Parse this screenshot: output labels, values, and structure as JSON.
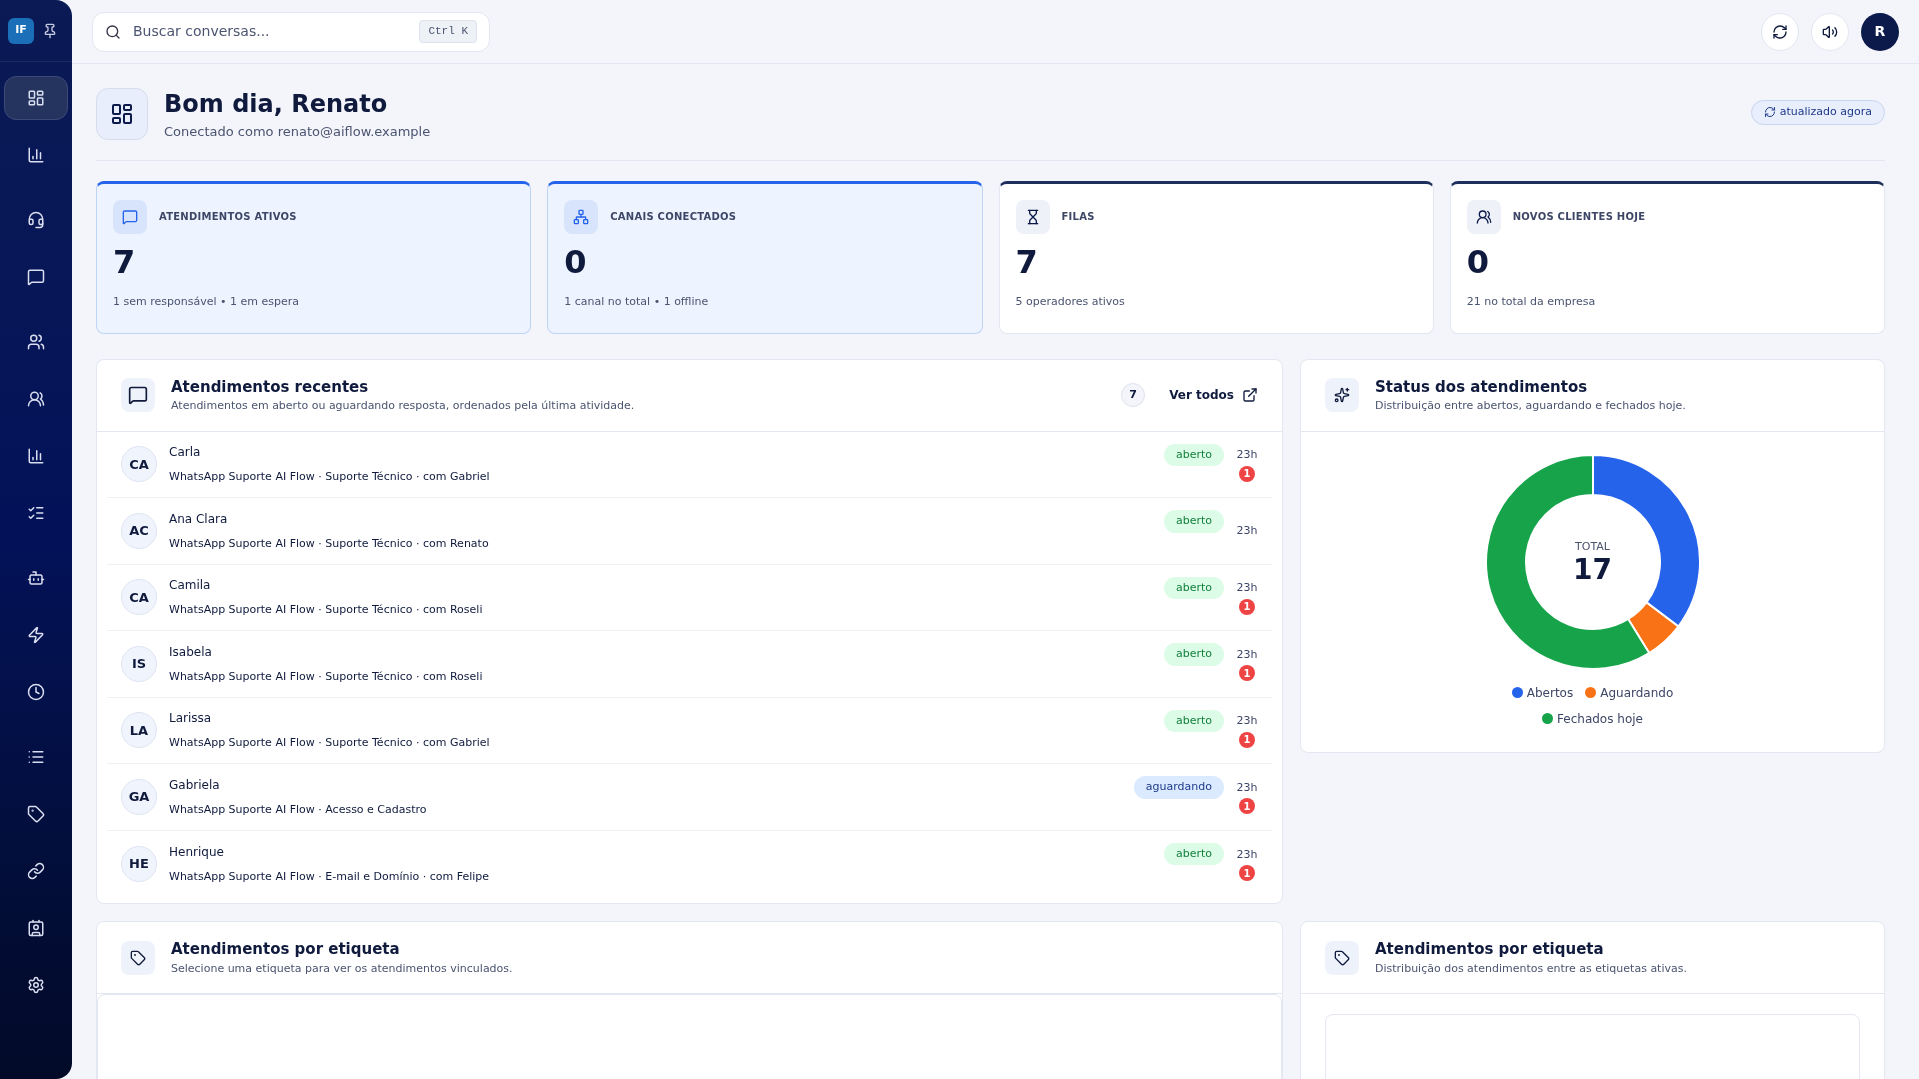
{
  "sidebar": {
    "logo": "IF",
    "items": [
      {
        "selected": true
      },
      {
        "selected": false
      },
      {
        "selected": false
      },
      {
        "selected": false
      },
      {
        "selected": false
      },
      {
        "selected": false
      },
      {
        "selected": false
      },
      {
        "selected": false
      },
      {
        "selected": false
      },
      {
        "selected": false
      },
      {
        "selected": false
      },
      {
        "selected": false
      },
      {
        "selected": false
      },
      {
        "selected": false
      },
      {
        "selected": false
      },
      {
        "selected": false
      }
    ]
  },
  "topbar": {
    "search": {
      "placeholder": "Buscar conversas...",
      "shortcut": "Ctrl K"
    },
    "avatar": "R"
  },
  "header": {
    "title": "Bom dia, Renato",
    "subtitle": "Conectado como renato@aiflow.example",
    "status": "atualizado agora"
  },
  "kpis": [
    {
      "label": "ATENDIMENTOS ATIVOS",
      "value": "7",
      "note": "1 sem responsável • 1 em espera",
      "highlighted": true
    },
    {
      "label": "CANAIS CONECTADOS",
      "value": "0",
      "note": "1 canal no total • 1 offline",
      "highlighted": true
    },
    {
      "label": "FILAS",
      "value": "7",
      "note": "5 operadores ativos",
      "highlighted": false
    },
    {
      "label": "NOVOS CLIENTES HOJE",
      "value": "0",
      "note": "21 no total da empresa",
      "highlighted": false
    }
  ],
  "recent": {
    "title": "Atendimentos recentes",
    "subtitle": "Atendimentos em aberto ou aguardando resposta, ordenados pela última atividade.",
    "count": "7",
    "link": "Ver todos",
    "rows": [
      {
        "initials": "CA",
        "name": "Carla",
        "detail": "WhatsApp Suporte AI Flow · Suporte Técnico · com Gabriel",
        "status": "aberto",
        "kind": "open",
        "time": "23h",
        "unread": "1"
      },
      {
        "initials": "AC",
        "name": "Ana Clara",
        "detail": "WhatsApp Suporte AI Flow · Suporte Técnico · com Renato",
        "status": "aberto",
        "kind": "open",
        "time": "23h"
      },
      {
        "initials": "CA",
        "name": "Camila",
        "detail": "WhatsApp Suporte AI Flow · Suporte Técnico · com Roseli",
        "status": "aberto",
        "kind": "open",
        "time": "23h",
        "unread": "1"
      },
      {
        "initials": "IS",
        "name": "Isabela",
        "detail": "WhatsApp Suporte AI Flow · Suporte Técnico · com Roseli",
        "status": "aberto",
        "kind": "open",
        "time": "23h",
        "unread": "1"
      },
      {
        "initials": "LA",
        "name": "Larissa",
        "detail": "WhatsApp Suporte AI Flow · Suporte Técnico · com Gabriel",
        "status": "aberto",
        "kind": "open",
        "time": "23h",
        "unread": "1"
      },
      {
        "initials": "GA",
        "name": "Gabriela",
        "detail": "WhatsApp Suporte AI Flow · Acesso e Cadastro",
        "status": "aguardando",
        "kind": "waiting",
        "time": "23h",
        "unread": "1"
      },
      {
        "initials": "HE",
        "name": "Henrique",
        "detail": "WhatsApp Suporte AI Flow · E-mail e Domínio · com Felipe",
        "status": "aberto",
        "kind": "open",
        "time": "23h",
        "unread": "1"
      }
    ]
  },
  "status_card": {
    "title": "Status dos atendimentos",
    "subtitle": "Distribuição entre abertos, aguardando e fechados hoje.",
    "total_label": "TOTAL",
    "total": "17",
    "chart_data": {
      "type": "donut",
      "categories": [
        "Abertos",
        "Aguardando",
        "Fechados hoje"
      ],
      "values": [
        35.3,
        5.9,
        58.8
      ]
    }
  },
  "tag_cards": [
    {
      "title": "Atendimentos por etiqueta",
      "subtitle": "Selecione uma etiqueta para ver os atendimentos vinculados."
    },
    {
      "title": "Atendimentos por etiqueta",
      "subtitle": "Distribuição dos atendimentos entre as etiquetas ativas."
    }
  ]
}
